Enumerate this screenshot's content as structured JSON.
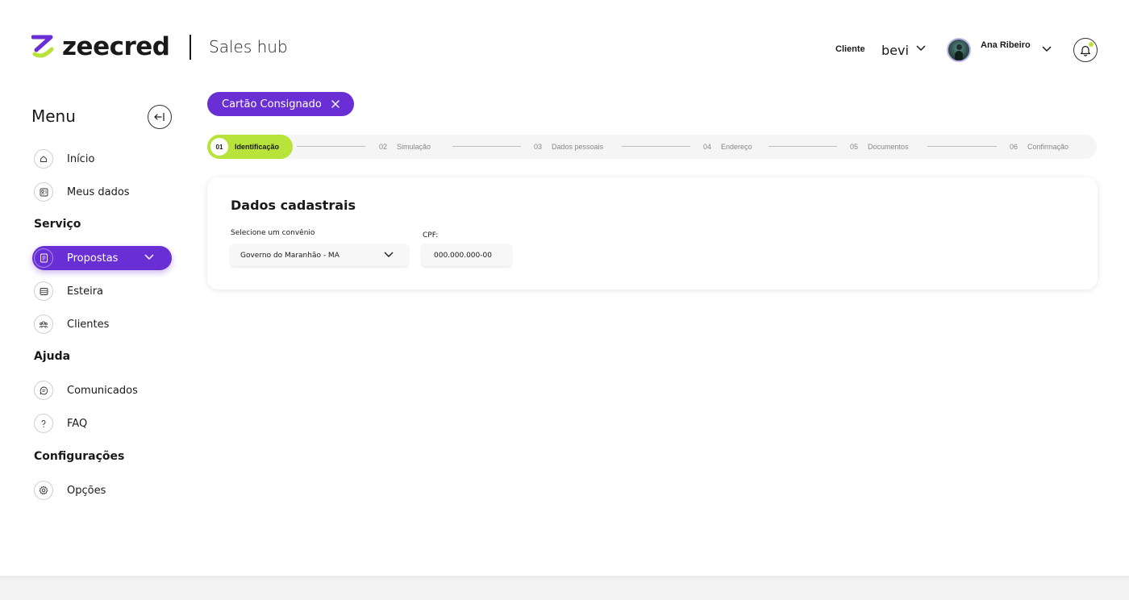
{
  "brand": {
    "logo_text": "zeecred",
    "app_name": "Sales hub",
    "logo_accent_color": "#b7e33a",
    "primary_color": "#6a2fd4"
  },
  "header": {
    "client_label": "Cliente",
    "client_name": "bevi",
    "user_name": "Ana Ribeiro"
  },
  "sidebar": {
    "title": "Menu",
    "items_top": [
      {
        "label": "Início",
        "icon": "home-icon"
      },
      {
        "label": "Meus dados",
        "icon": "user-data-icon"
      }
    ],
    "section_service": "Serviço",
    "items_service": [
      {
        "label": "Propostas",
        "icon": "proposal-icon",
        "active": true
      },
      {
        "label": "Esteira",
        "icon": "pipeline-icon"
      },
      {
        "label": "Clientes",
        "icon": "clients-icon"
      }
    ],
    "section_help": "Ajuda",
    "items_help": [
      {
        "label": "Comunicados",
        "icon": "chat-icon"
      },
      {
        "label": "FAQ",
        "icon": "question-icon"
      }
    ],
    "section_settings": "Configurações",
    "items_settings": [
      {
        "label": "Opções",
        "icon": "gear-icon"
      }
    ]
  },
  "product_chip": {
    "label": "Cartão Consignado"
  },
  "stepper": {
    "steps": [
      {
        "num": "01",
        "label": "Identificação",
        "active": true
      },
      {
        "num": "02",
        "label": "Simulação"
      },
      {
        "num": "03",
        "label": "Dados pessoais"
      },
      {
        "num": "04",
        "label": "Endereço"
      },
      {
        "num": "05",
        "label": "Documentos"
      },
      {
        "num": "06",
        "label": "Confirmação"
      }
    ]
  },
  "form": {
    "title": "Dados cadastrais",
    "convenio_label": "Selecione um convênio",
    "convenio_value": "Governo do Maranhão - MA",
    "cpf_label": "CPF:",
    "cpf_value": "000.000.000-00"
  }
}
